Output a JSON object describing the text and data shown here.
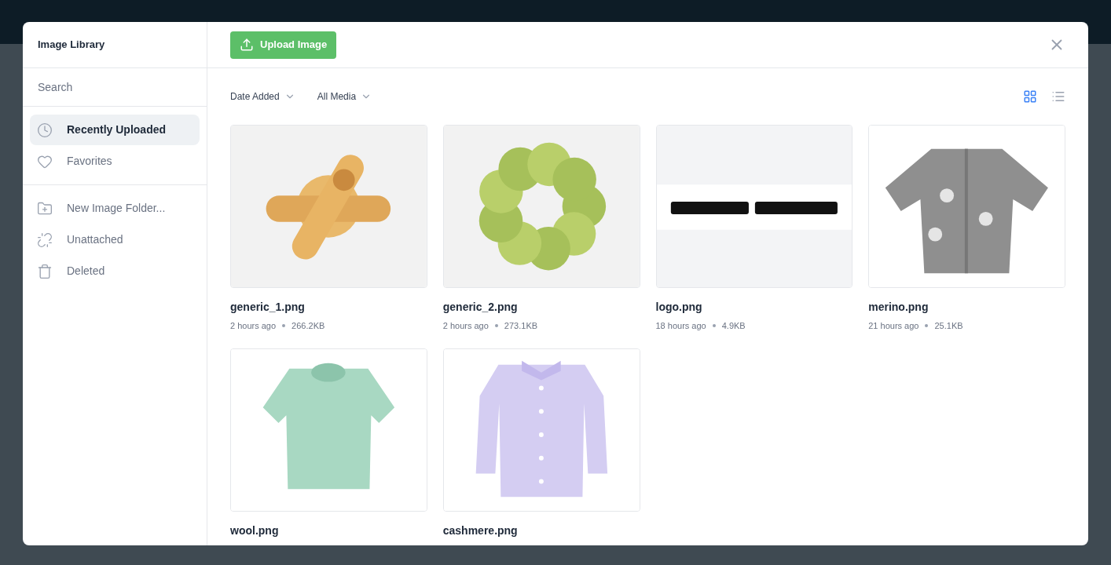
{
  "dialog": {
    "title": "Image Library",
    "upload_button": "Upload Image"
  },
  "search": {
    "placeholder": "Search"
  },
  "nav_groups": [
    [
      {
        "label": "Recently Uploaded",
        "kind": "clock",
        "selected": true
      },
      {
        "label": "Favorites",
        "kind": "heart",
        "selected": false
      }
    ],
    [
      {
        "label": "New Image Folder...",
        "kind": "folder",
        "selected": false
      },
      {
        "label": "Unattached",
        "kind": "unlink",
        "selected": false
      },
      {
        "label": "Deleted",
        "kind": "trash",
        "selected": false
      }
    ]
  ],
  "filters": [
    {
      "label": "Date Added"
    },
    {
      "label": "All Media"
    }
  ],
  "view_modes": [
    {
      "kind": "grid",
      "selected": true
    },
    {
      "kind": "list",
      "selected": false
    }
  ],
  "images": [
    {
      "name": "generic_1.png",
      "age": "2 hours ago",
      "size": "266.2KB"
    },
    {
      "name": "generic_2.png",
      "age": "2 hours ago",
      "size": "273.1KB"
    },
    {
      "name": "logo.png",
      "age": "18 hours ago",
      "size": "4.9KB"
    },
    {
      "name": "merino.png",
      "age": "21 hours ago",
      "size": "25.1KB"
    },
    {
      "name": "wool.png"
    },
    {
      "name": "cashmere.png"
    }
  ]
}
